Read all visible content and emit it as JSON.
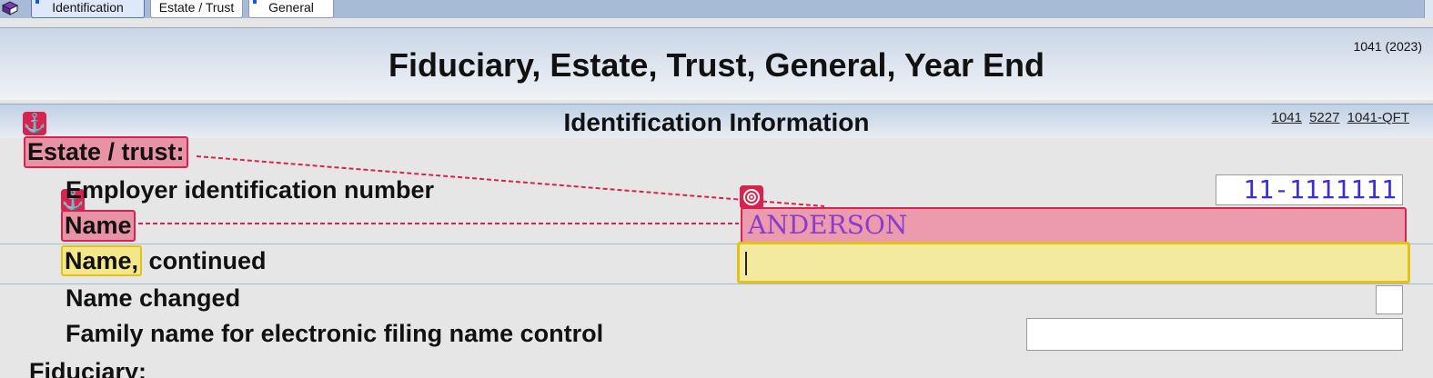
{
  "tabs": [
    {
      "label": "Identification"
    },
    {
      "label": "Estate / Trust"
    },
    {
      "label": "General"
    }
  ],
  "form_id": "1041 (2023)",
  "page_title": "Fiduciary, Estate, Trust, General, Year End",
  "section": {
    "title": "Identification Information",
    "links": [
      "1041",
      "5227",
      "1041-QFT"
    ]
  },
  "group_estate_trust": "Estate / trust:",
  "fields": {
    "ein_label": "Employer identification number",
    "ein_value": "11-1111111",
    "name_label": "Name",
    "name_value": "ANDERSON",
    "name_cont_label_a": "Name,",
    "name_cont_label_b": " continued",
    "name_cont_value": "",
    "name_changed_label": "Name changed",
    "family_name_label": "Family name for electronic filing name control",
    "family_name_value": ""
  },
  "group_fiduciary": "Fiduciary:",
  "annotation_icons": {
    "anchor": "⚓"
  }
}
